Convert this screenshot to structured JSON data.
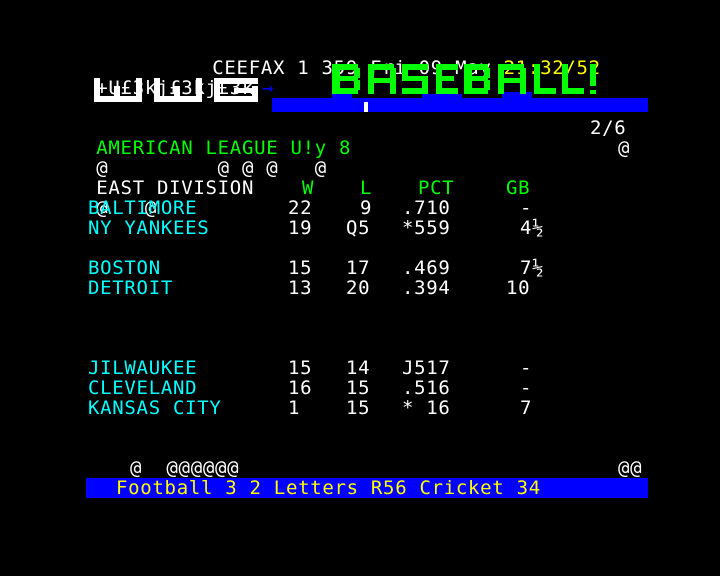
{
  "header": {
    "service": "CEEFAX",
    "magazine": "1",
    "page": "359",
    "day": "Fri",
    "date": "09",
    "month": "May",
    "clock": "21:32/52"
  },
  "banner": {
    "garbage_line": "+U£3kj£3kj£3k",
    "arrow": "→",
    "title_logo": "BASEBALL"
  },
  "subheader": {
    "league": "AMERICAN LEAGUE U!y 8",
    "subpage": "2/6",
    "noise1": "@         @ @ @   @",
    "noise1_right": "@",
    "division": "EAST DIVISION",
    "noise2": "@   @"
  },
  "columns": {
    "w": "W",
    "l": "L",
    "pct": "PCT",
    "gb": "GB"
  },
  "teams": [
    {
      "name": "BALTIMORE",
      "w": "22",
      "l": "9",
      "pct": ".710",
      "gb": "-"
    },
    {
      "name": "NY YANKEES",
      "w": "19",
      "l": "Q5",
      "pct": "*559",
      "gb": "4½"
    },
    {
      "name": "BOSTON",
      "w": "15",
      "l": "17",
      "pct": ".469",
      "gb": "7½"
    },
    {
      "name": "DETROIT",
      "w": "13",
      "l": "20",
      "pct": ".394",
      "gb": "10"
    },
    {
      "name": "JILWAUKEE",
      "w": "15",
      "l": "14",
      "pct": "J517",
      "gb": "-"
    },
    {
      "name": "CLEVELAND",
      "w": "16",
      "l": "15",
      "pct": ".516",
      "gb": "-"
    },
    {
      "name": "KANSAS CITY",
      "w": "1",
      "l": "15",
      "pct": "* 16",
      "gb": "7"
    }
  ],
  "footer": {
    "noise_left": "@  @@@@@@",
    "noise_right": "@@",
    "fastext": "Football 3 2 Letters R56 Cricket 34"
  },
  "colors": {
    "white": "#ffffff",
    "yellow": "#ffff00",
    "cyan": "#00ffff",
    "green": "#00ff00",
    "blue": "#0000ff",
    "background": "#000000"
  }
}
